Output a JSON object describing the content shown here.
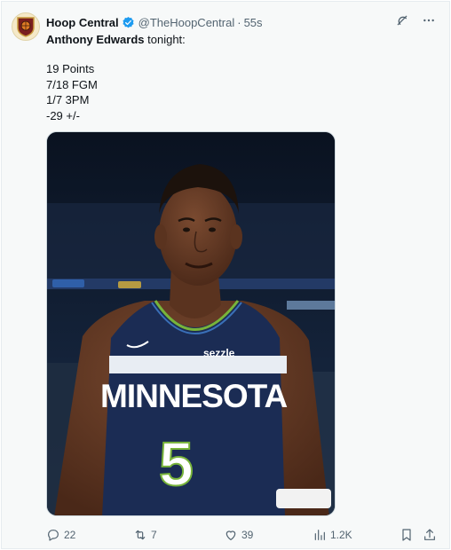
{
  "tweet": {
    "author_name": "Hoop Central",
    "author_handle": "@TheHoopCentral",
    "separator": "·",
    "time": "55s",
    "player_name": "Anthony Edwards",
    "intro_rest": " tonight:",
    "stats": [
      "19 Points",
      "7/18 FGM",
      "1/7 3PM",
      "-29 +/-"
    ],
    "photo": {
      "jersey_team": "MINNESOTA",
      "jersey_number": "5",
      "sponsor": "sezzle"
    },
    "actions": {
      "replies": "22",
      "reposts": "7",
      "likes": "39",
      "views": "1.2K"
    }
  },
  "icons": [
    "verified-badge-icon",
    "grok-icon",
    "more-icon",
    "reply-icon",
    "repost-icon",
    "like-icon",
    "views-icon",
    "bookmark-icon",
    "share-icon"
  ],
  "colors": {
    "verified": "#1d9bf0",
    "muted": "#536471",
    "jersey_navy": "#1b2c54"
  }
}
